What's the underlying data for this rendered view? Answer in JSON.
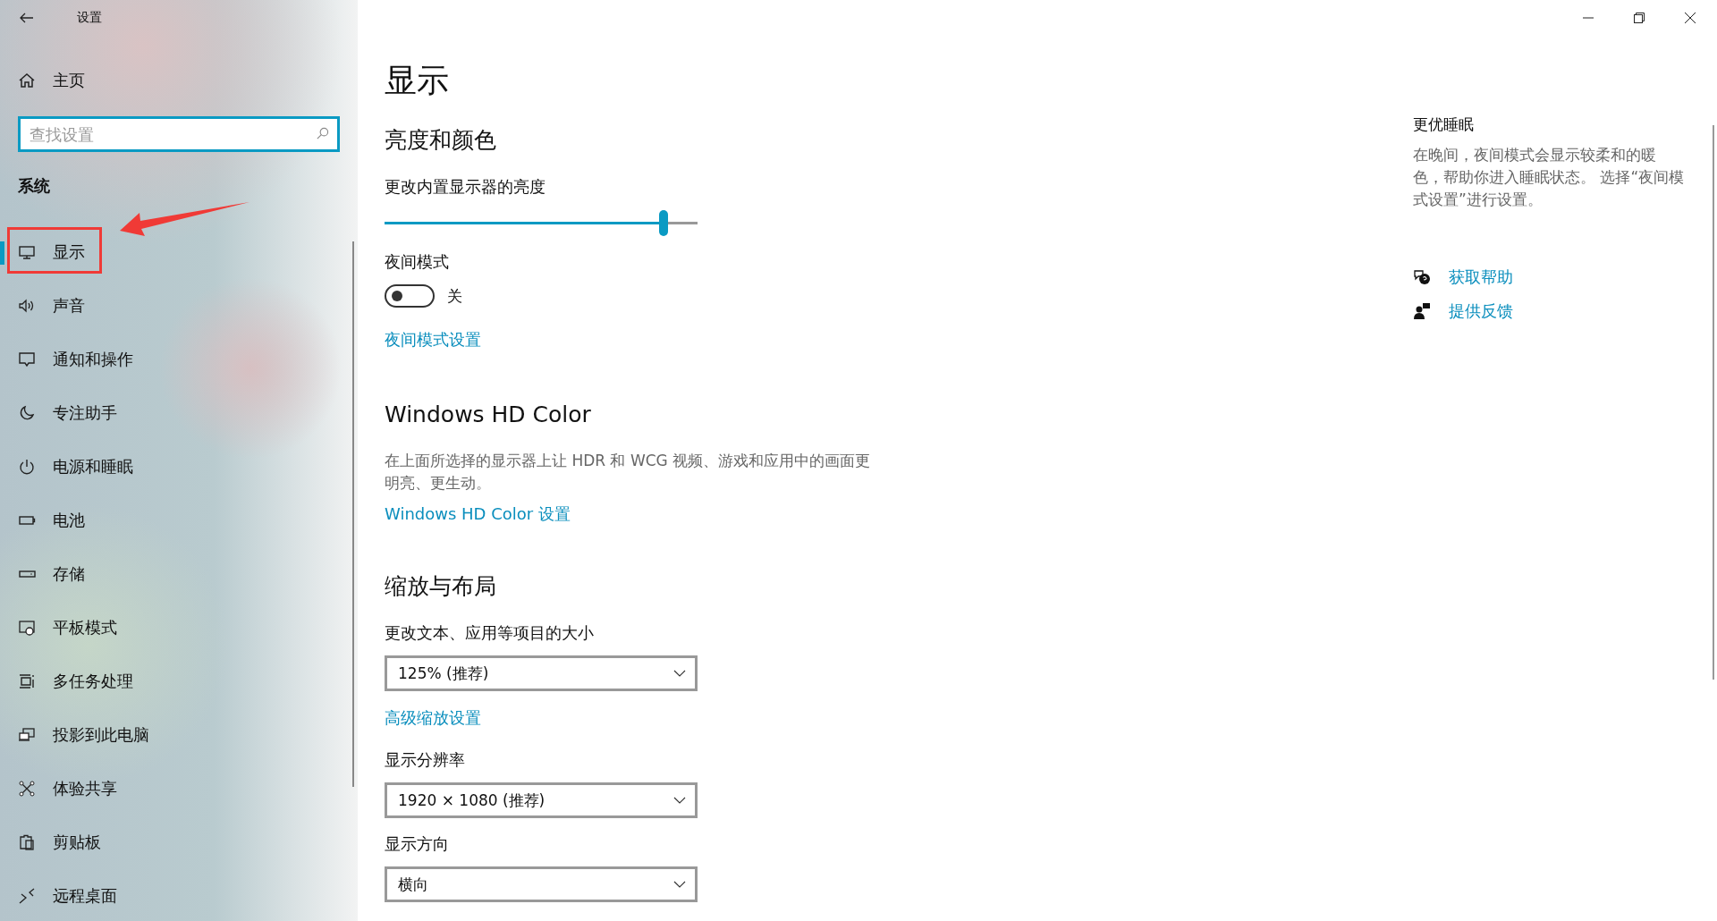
{
  "window": {
    "title": "设置"
  },
  "sidebar": {
    "home": "主页",
    "search": {
      "placeholder": "查找设置"
    },
    "section": "系统",
    "items": [
      {
        "label": "显示",
        "selected": true
      },
      {
        "label": "声音",
        "selected": false
      },
      {
        "label": "通知和操作",
        "selected": false
      },
      {
        "label": "专注助手",
        "selected": false
      },
      {
        "label": "电源和睡眠",
        "selected": false
      },
      {
        "label": "电池",
        "selected": false
      },
      {
        "label": "存储",
        "selected": false
      },
      {
        "label": "平板模式",
        "selected": false
      },
      {
        "label": "多任务处理",
        "selected": false
      },
      {
        "label": "投影到此电脑",
        "selected": false
      },
      {
        "label": "体验共享",
        "selected": false
      },
      {
        "label": "剪贴板",
        "selected": false
      },
      {
        "label": "远程桌面",
        "selected": false
      }
    ],
    "annotation": {
      "kind": "box-arrow"
    }
  },
  "main": {
    "title": "显示",
    "brightness": {
      "heading": "亮度和颜色",
      "label": "更改内置显示器的亮度",
      "level": 0.89
    },
    "night_light": {
      "label": "夜间模式",
      "on": false,
      "state": "关",
      "link": "夜间模式设置"
    },
    "hd_color": {
      "heading": "Windows HD Color",
      "description": "在上面所选择的显示器上让 HDR 和 WCG 视频、游戏和应用中的画面更明亮、更生动。",
      "link": "Windows HD Color 设置"
    },
    "scale": {
      "heading": "缩放与布局",
      "fields": [
        {
          "kind": "dropdown",
          "label": "更改文本、应用等项目的大小",
          "value": "125% (推荐)"
        },
        {
          "kind": "link",
          "label": "高级缩放设置"
        },
        {
          "kind": "dropdown",
          "label": "显示分辨率",
          "value": "1920 × 1080 (推荐)"
        },
        {
          "kind": "dropdown",
          "label": "显示方向",
          "value": "横向"
        }
      ]
    }
  },
  "aside": {
    "heading": "更优睡眠",
    "description": "在晚间，夜间模式会显示较柔和的暖色，帮助你进入睡眠状态。 选择“夜间模式设置”进行设置。",
    "links": [
      "获取帮助",
      "提供反馈"
    ]
  }
}
